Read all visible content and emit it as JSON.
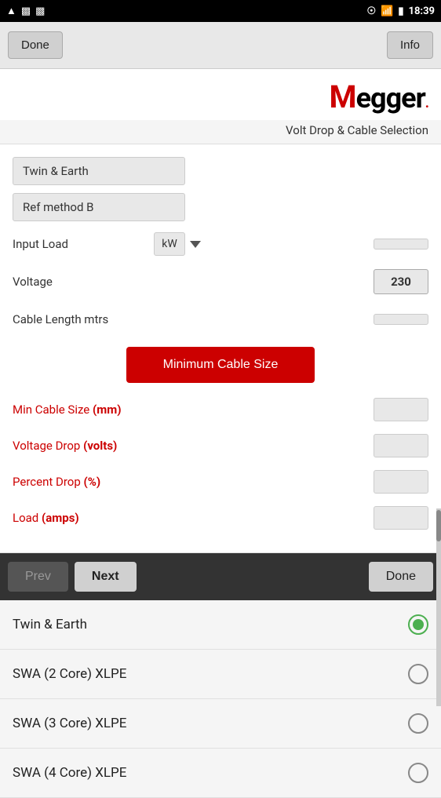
{
  "statusBar": {
    "time": "18:39",
    "icons": [
      "sim",
      "image",
      "message",
      "eye",
      "wifi",
      "battery"
    ]
  },
  "toolbar": {
    "doneLabel": "Done",
    "infoLabel": "Info"
  },
  "logo": {
    "text": "Megger",
    "dot": "."
  },
  "subtitle": "Volt Drop & Cable Selection",
  "selectors": {
    "cableType": "Twin & Earth",
    "refMethod": "Ref method B"
  },
  "fields": {
    "inputLoad": {
      "label": "Input Load",
      "unit": "kW"
    },
    "voltage": {
      "label": "Voltage",
      "value": "230"
    },
    "cableLength": {
      "label": "Cable Length mtrs"
    }
  },
  "minCableSizeBtn": "Minimum Cable Size",
  "results": {
    "minCableSize": {
      "label": "Min Cable Size",
      "unit": "(mm)"
    },
    "voltageDrop": {
      "label": "Voltage Drop",
      "unit": "(volts)"
    },
    "percentDrop": {
      "label": "Percent Drop",
      "unit": "(%)"
    },
    "load": {
      "label": "Load",
      "unit": "(amps)"
    }
  },
  "bottomNav": {
    "prevLabel": "Prev",
    "nextLabel": "Next",
    "doneLabel": "Done"
  },
  "listItems": [
    {
      "label": "Twin & Earth",
      "selected": true
    },
    {
      "label": "SWA (2 Core) XLPE",
      "selected": false
    },
    {
      "label": "SWA (3 Core) XLPE",
      "selected": false
    },
    {
      "label": "SWA (4 Core) XLPE",
      "selected": false
    }
  ]
}
